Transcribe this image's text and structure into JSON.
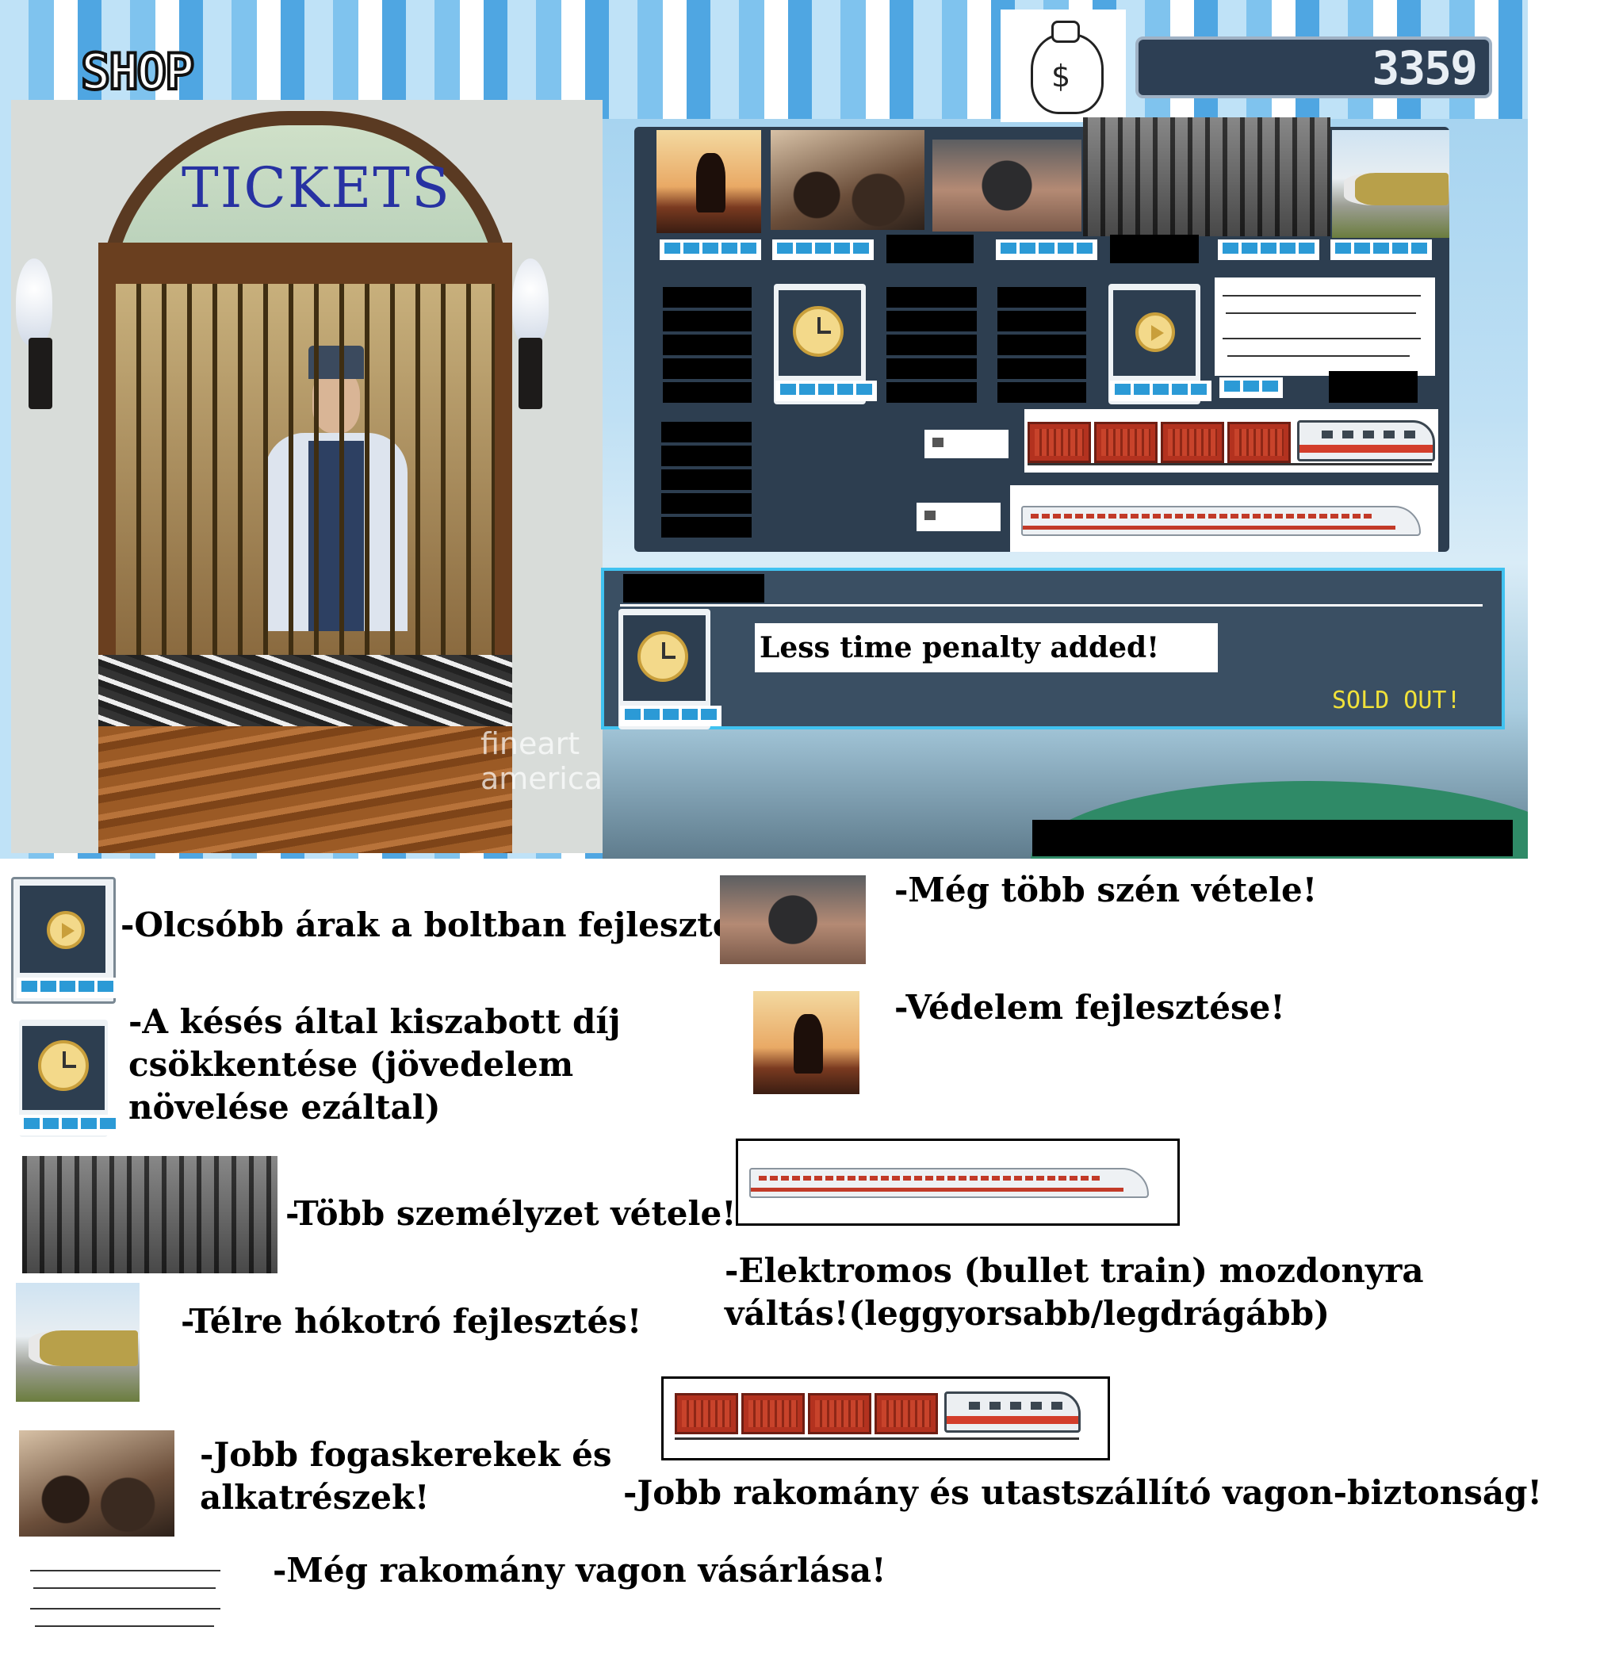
{
  "shop": {
    "title": "SHOP",
    "booth_sign": "TICKETS",
    "watermark": [
      "fineart",
      "america"
    ],
    "money": "3359",
    "currency_icon": "money-bag-icon",
    "info_message": "Less time penalty added!",
    "status": "SOLD OUT!"
  },
  "legend": {
    "cheaper_prices": "-Olcsóbb árak a boltban fejlesztés!",
    "late_penalty": [
      "-A késés által kiszabott díj",
      "csökkentése (jövedelem",
      "növelése ezáltal)"
    ],
    "more_staff": "-Több személyzet vétele!",
    "snowplow": "-Télre hókotró fejlesztés!",
    "gears": [
      "-Jobb fogaskerekek és",
      "alkatrészek!"
    ],
    "cargo_wagon": "-Még rakomány vagon vásárlása!",
    "more_coal": "-Még több szén vétele!",
    "defense": "-Védelem fejlesztése!",
    "electric_loco": [
      "-Elektromos (bullet train) mozdonyra",
      "váltás!(leggyorsabb/legdrágább)"
    ],
    "wagon_safety": "-Jobb rakomány és utastszállító vagon-biztonság!"
  },
  "colors": {
    "panel": "#2d3e50",
    "pip": "#2b9ad6",
    "sold_out": "#f0e13a",
    "info_border": "#40c2f0"
  }
}
